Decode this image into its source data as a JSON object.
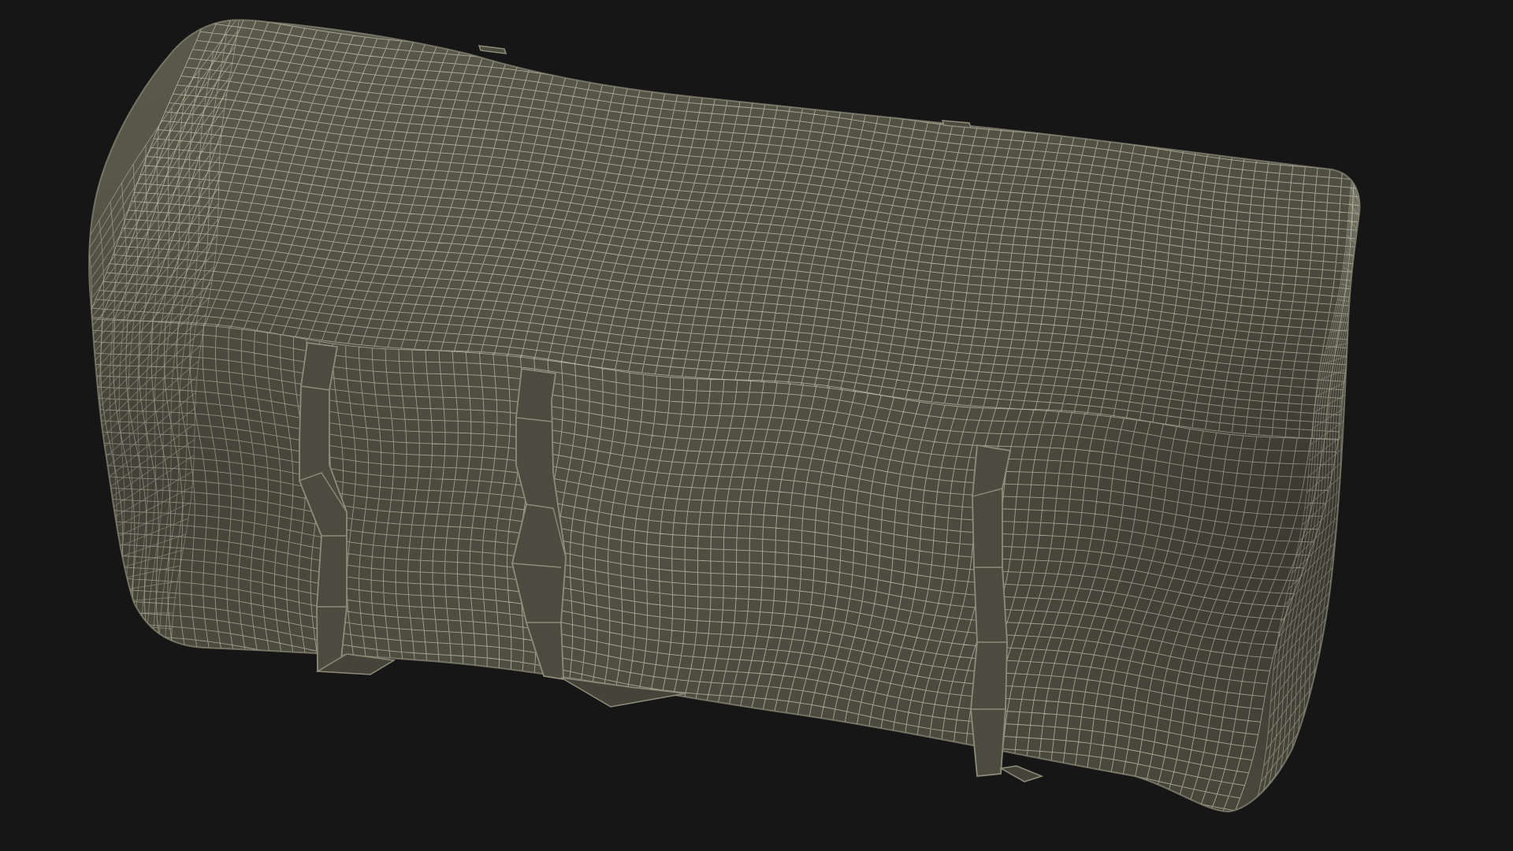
{
  "viewport": {
    "background_color": "#161616",
    "object": {
      "name": "wireframe-duffel-bag",
      "surface_color": "#505043",
      "shade_color": "#45453a",
      "highlight_color": "#5a5a4c",
      "wire_color": "#c9c6b3",
      "strap_color": "#4b4b3f",
      "strap_edge_color": "#8e8c79",
      "strap_count": 3
    }
  }
}
